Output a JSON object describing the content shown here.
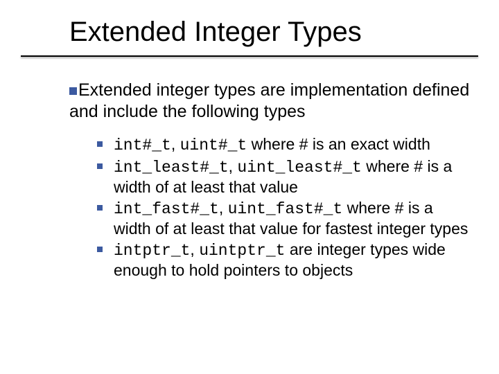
{
  "title": "Extended Integer Types",
  "intro": "Extended integer types are implementation defined and include the following types",
  "b1": {
    "c1": "int#_t",
    "sep": ", ",
    "c2": "uint#_t",
    "tail": " where # is an exact width"
  },
  "b2": {
    "c1": "int_least#_t",
    "sep": ", ",
    "c2": "uint_least#_t",
    "tail1": " where # is a width of at least that value"
  },
  "b3": {
    "c1": "int_fast#_t",
    "sep": ", ",
    "c2": "uint_fast#_t",
    "tail": " where # is a width of at least that value for fastest integer types"
  },
  "b4": {
    "c1": "intptr_t",
    "sep": ", ",
    "c2": "uintptr_t",
    "tail": " are integer types wide enough to hold pointers to objects"
  }
}
